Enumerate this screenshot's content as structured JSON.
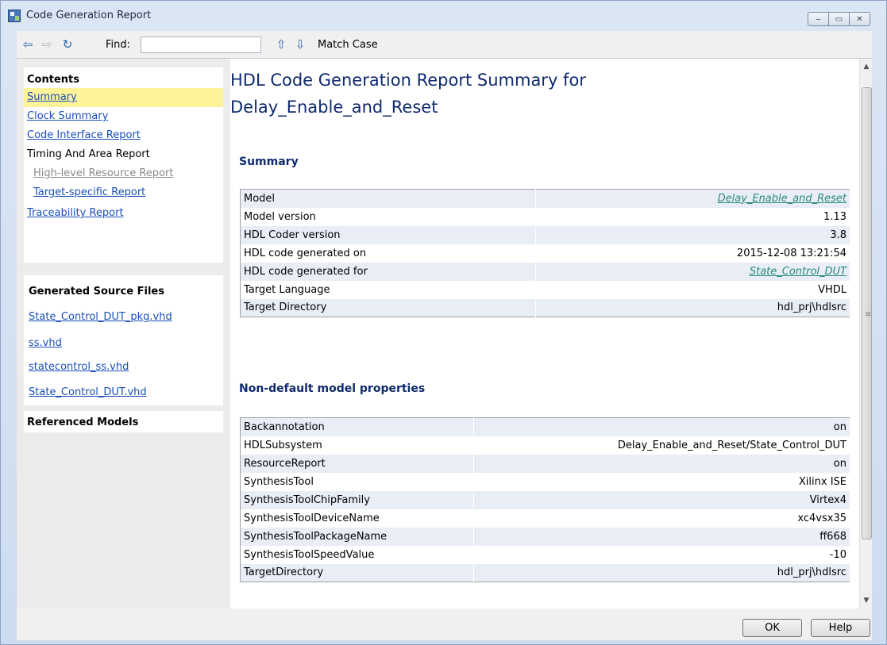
{
  "window": {
    "title": "Code Generation Report",
    "controls": {
      "minimize": "‒",
      "maximize": "▭",
      "close": "✕"
    }
  },
  "toolbar": {
    "back_icon": "⇦",
    "forward_icon": "⇨",
    "refresh_icon": "↻",
    "find_label": "Find:",
    "find_value": "",
    "up_icon": "⇧",
    "down_icon": "⇩",
    "match_case": "Match Case"
  },
  "sidebar": {
    "contents_title": "Contents",
    "items": [
      {
        "label": "Summary"
      },
      {
        "label": "Clock Summary"
      },
      {
        "label": "Code Interface Report"
      },
      {
        "label": "Timing And Area Report"
      },
      {
        "label": "High-level Resource Report"
      },
      {
        "label": "Target-specific Report"
      },
      {
        "label": "Traceability Report"
      }
    ],
    "files_title": "Generated Source Files",
    "files": [
      "State_Control_DUT_pkg.vhd",
      "ss.vhd",
      "statecontrol_ss.vhd",
      "State_Control_DUT.vhd"
    ],
    "referenced_title": "Referenced Models"
  },
  "main": {
    "title_line1": "HDL Code Generation Report Summary for",
    "title_line2": "Delay_Enable_and_Reset",
    "summary_heading": "Summary",
    "summary_rows": [
      {
        "key": "Model",
        "value": "Delay_Enable_and_Reset"
      },
      {
        "key": "Model version",
        "value": "1.13"
      },
      {
        "key": "HDL Coder version",
        "value": "3.8"
      },
      {
        "key": "HDL code generated on",
        "value": "2015-12-08 13:21:54"
      },
      {
        "key": "HDL code generated for",
        "value": "State_Control_DUT"
      },
      {
        "key": "Target Language",
        "value": "VHDL"
      },
      {
        "key": "Target Directory",
        "value": "hdl_prj\\hdlsrc"
      }
    ],
    "props_heading": "Non-default model properties",
    "props_rows": [
      {
        "key": "Backannotation",
        "value": "on"
      },
      {
        "key": "HDLSubsystem",
        "value": "Delay_Enable_and_Reset/State_Control_DUT"
      },
      {
        "key": "ResourceReport",
        "value": "on"
      },
      {
        "key": "SynthesisTool",
        "value": "Xilinx ISE"
      },
      {
        "key": "SynthesisToolChipFamily",
        "value": "Virtex4"
      },
      {
        "key": "SynthesisToolDeviceName",
        "value": "xc4vsx35"
      },
      {
        "key": "SynthesisToolPackageName",
        "value": "ff668"
      },
      {
        "key": "SynthesisToolSpeedValue",
        "value": "-10"
      },
      {
        "key": "TargetDirectory",
        "value": "hdl_prj\\hdlsrc"
      }
    ]
  },
  "scrollbar": {
    "up": "▲",
    "down": "▼",
    "grip": "≡"
  },
  "buttons": {
    "ok": "OK",
    "help": "Help"
  }
}
